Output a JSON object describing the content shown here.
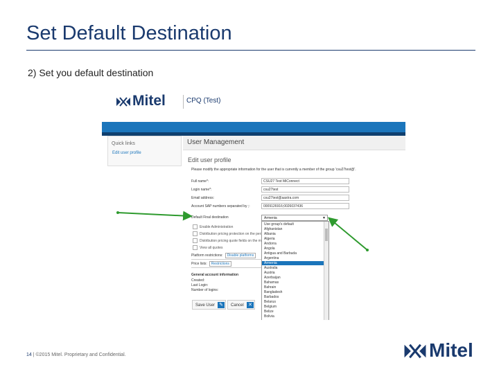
{
  "slide": {
    "title": "Set Default Destination",
    "step": "2)  Set you default destination",
    "footer_page": "14",
    "footer_sep": " | ",
    "footer_text": "©2015 Mitel. Proprietary and Confidential.",
    "footer_logo": "Mitel",
    "brand_color": "#1a3a6e",
    "arrow_color": "#2e9a2e"
  },
  "app": {
    "logo": "Mitel",
    "environment": "CPQ (Test)",
    "quick_links": {
      "title": "Quick links",
      "link": "Edit user profile"
    },
    "header": "User Management",
    "page_title": "Edit user profile",
    "instructions": "Please modify the appropriate information for the user that is currently a member of the group 'csu27test@'.",
    "fields": [
      {
        "label": "Full name*:",
        "value": "CSU27 Test MiConnect"
      },
      {
        "label": "Login name*:",
        "value": "csu27test"
      },
      {
        "label": "Email address:",
        "value": "csu27test@aastra.com"
      },
      {
        "label": "Account SAP numbers separated by ;:",
        "value": "0009126916;0026037436"
      }
    ],
    "default_dest": {
      "label": "Default Final destination",
      "selected": "Armenia"
    },
    "checkboxes": [
      "Enable Administration",
      "Distribution pricing protection on the pers",
      "Distribution pricing quote fields on the main",
      "View all quotes"
    ],
    "platform_restrictions": {
      "label": "Platform restrictions:",
      "value": "Disable platforms"
    },
    "price_lists": {
      "label": "Price lists:",
      "value": "Restrictions"
    },
    "account_info": {
      "title": "General account information",
      "rows": [
        "Created:",
        "Last Login:",
        "Number of logins:"
      ]
    },
    "buttons": {
      "save": "Save User",
      "cancel": "Cancel"
    },
    "dropdown_options": [
      "Use group's default",
      "Afghanistan",
      "Albania",
      "Algeria",
      "Andorra",
      "Angola",
      "Antigua and Barbuda",
      "Argentina",
      "Armenia",
      "Australia",
      "Austria",
      "Azerbaijan",
      "Bahamas",
      "Bahrain",
      "Bangladesh",
      "Barbados",
      "Belarus",
      "Belgium",
      "Belize",
      "Bolivia"
    ],
    "accent_color": "#1b75bb"
  }
}
